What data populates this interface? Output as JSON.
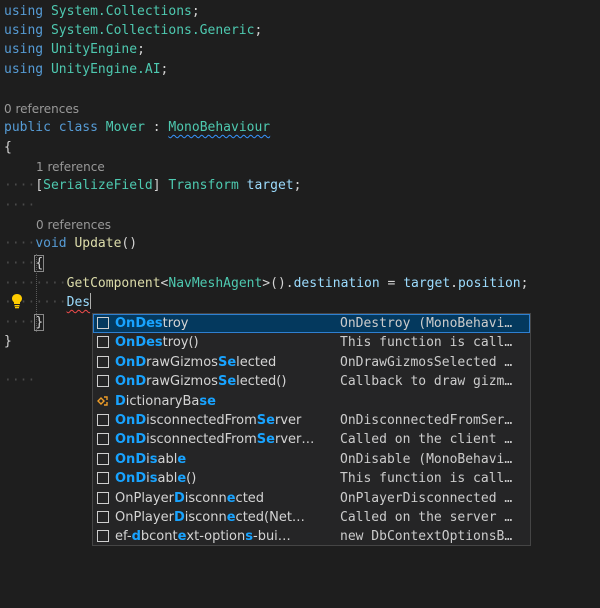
{
  "code": {
    "using_keyword": "using",
    "using_lines": [
      {
        "ns": "System.Collections",
        "semi": ";"
      },
      {
        "ns": "System.Collections.Generic",
        "semi": ";"
      },
      {
        "ns": "UnityEngine",
        "semi": ";"
      },
      {
        "ns": "UnityEngine.AI",
        "semi": ";"
      }
    ],
    "class_refs": "0 references",
    "public_kw": "public",
    "class_kw": "class",
    "class_name": "Mover",
    "colon": ":",
    "base_class": "MonoBehaviour",
    "open_brace": "{",
    "field_refs": "1 reference",
    "field_attr_open": "[",
    "field_attr": "SerializeField",
    "field_attr_close": "]",
    "field_type": "Transform",
    "field_name": "target",
    "field_semi": ";",
    "method_refs": "0 references",
    "void_kw": "void",
    "method_name": "Update",
    "method_parens": "()",
    "method_open": "{",
    "stmt_get": "GetComponent",
    "stmt_lt": "<",
    "stmt_type": "NavMeshAgent",
    "stmt_gt_call": ">().",
    "stmt_prop": "destination",
    "stmt_eq": " = ",
    "stmt_target": "target",
    "stmt_dot": ".",
    "stmt_pos": "position",
    "stmt_semi": ";",
    "typed_text": "Des",
    "method_close": "}",
    "class_close": "}",
    "indent_dots": "····"
  },
  "suggestions": [
    {
      "pre": "",
      "m1": "On",
      "mid": "",
      "m2": "Des",
      "post": "troy",
      "detail": "OnDestroy (MonoBehavi…",
      "icon": "method-icon",
      "selected": true
    },
    {
      "pre": "",
      "m1": "On",
      "mid": "",
      "m2": "Des",
      "post": "troy()",
      "detail": "This function is call…",
      "icon": "method-icon",
      "selected": false
    },
    {
      "pre": "",
      "m1": "On",
      "mid": "",
      "m2": "D",
      "post": "rawGizmos",
      "m3": "Se",
      "post2": "lected",
      "detail": "OnDrawGizmosSelected …",
      "icon": "method-icon",
      "selected": false
    },
    {
      "pre": "",
      "m1": "On",
      "mid": "",
      "m2": "D",
      "post": "rawGizmos",
      "m3": "Se",
      "post2": "lected()",
      "detail": "Callback to draw gizm…",
      "icon": "method-icon",
      "selected": false
    },
    {
      "pre": "",
      "m1": "D",
      "mid": "ictionaryBa",
      "m2": "se",
      "post": "",
      "detail": "",
      "icon": "class-icon",
      "selected": false
    },
    {
      "pre": "",
      "m1": "On",
      "mid": "",
      "m2": "D",
      "post": "isconnectedFrom",
      "m3": "Se",
      "post2": "rver",
      "detail": "OnDisconnectedFromSer…",
      "icon": "method-icon",
      "selected": false
    },
    {
      "pre": "",
      "m1": "On",
      "mid": "",
      "m2": "D",
      "post": "isconnectedFrom",
      "m3": "Se",
      "post2": "rver…",
      "detail": "Called on the client …",
      "icon": "method-icon",
      "selected": false
    },
    {
      "pre": "",
      "m1": "On",
      "mid": "",
      "m2": "D",
      "post": "i",
      "m3": "s",
      "post2": "abl",
      "m4": "e",
      "post3": "",
      "detail": "OnDisable (MonoBehavi…",
      "icon": "method-icon",
      "selected": false
    },
    {
      "pre": "",
      "m1": "On",
      "mid": "",
      "m2": "D",
      "post": "i",
      "m3": "s",
      "post2": "abl",
      "m4": "e",
      "post3": "()",
      "detail": "This function is call…",
      "icon": "method-icon",
      "selected": false
    },
    {
      "pre": "On",
      "m1": "",
      "mid": "Player",
      "m2": "D",
      "post": "isconn",
      "m3": "e",
      "post2": "cted",
      "detail": "OnPlayerDisconnected …",
      "icon": "method-icon",
      "selected": false
    },
    {
      "pre": "On",
      "m1": "",
      "mid": "Player",
      "m2": "D",
      "post": "isconn",
      "m3": "e",
      "post2": "cted(Net…",
      "detail": "Called on the server …",
      "icon": "method-icon",
      "selected": false
    },
    {
      "pre": "ef-",
      "m1": "d",
      "mid": "bcont",
      "m2": "e",
      "post": "xt-option",
      "m3": "s",
      "post2": "-bui…",
      "detail": "new DbContextOptionsB…",
      "icon": "snippet-icon",
      "selected": false
    }
  ]
}
